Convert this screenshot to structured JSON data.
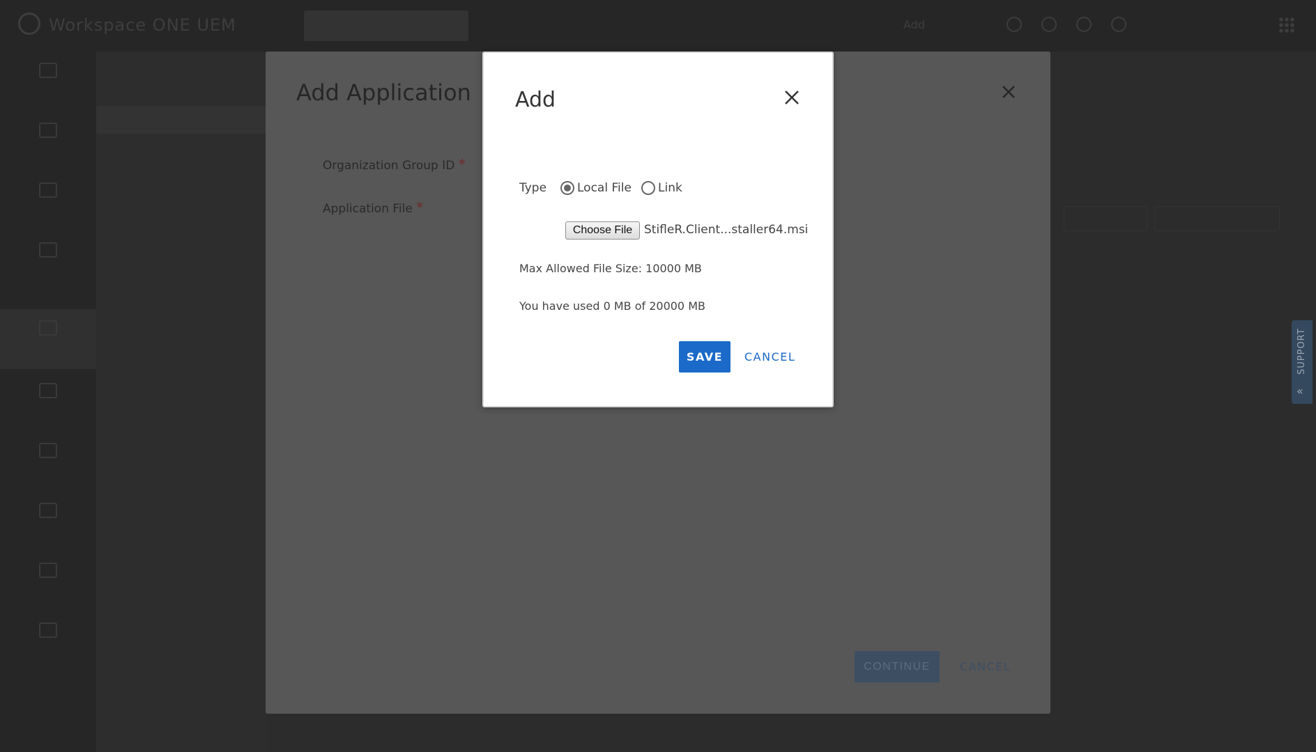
{
  "topbar": {
    "app_title": "Workspace ONE UEM",
    "org_group": "",
    "add_label": "Add",
    "user_label": ""
  },
  "left_nav": {
    "items": [
      "",
      "",
      "",
      "",
      "",
      "",
      "",
      "",
      "",
      ""
    ],
    "collapse_label": ""
  },
  "sub_nav": {
    "header": "",
    "items": [
      "",
      "",
      "",
      "",
      "",
      "",
      "",
      "",
      "",
      ""
    ]
  },
  "add_application_modal": {
    "title": "Add Application",
    "fields": {
      "org_group_id": "Organization Group ID",
      "application_file": "Application File"
    },
    "required_mark": "*",
    "continue_label": "CONTINUE",
    "cancel_label": "CANCEL"
  },
  "add_dialog": {
    "title": "Add",
    "type_label": "Type",
    "options": [
      {
        "label": "Local File",
        "selected": true
      },
      {
        "label": "Link",
        "selected": false
      }
    ],
    "choose_file_label": "Choose File",
    "file_name": "StifleR.Client...staller64.msi",
    "max_size_text": "Max Allowed File Size: 10000 MB",
    "usage_text": "You have used 0 MB of 20000 MB",
    "save_label": "SAVE",
    "cancel_label": "CANCEL"
  },
  "support_tab": {
    "label": "SUPPORT"
  },
  "icons": {
    "close": "close-icon",
    "support": "chevron-double-up-icon",
    "logo": "logo-icon",
    "apps": "grid-icon"
  },
  "colors": {
    "primary": "#1b6ac9",
    "dimmed_overlay": "#575757",
    "required": "#6f2a2a"
  }
}
